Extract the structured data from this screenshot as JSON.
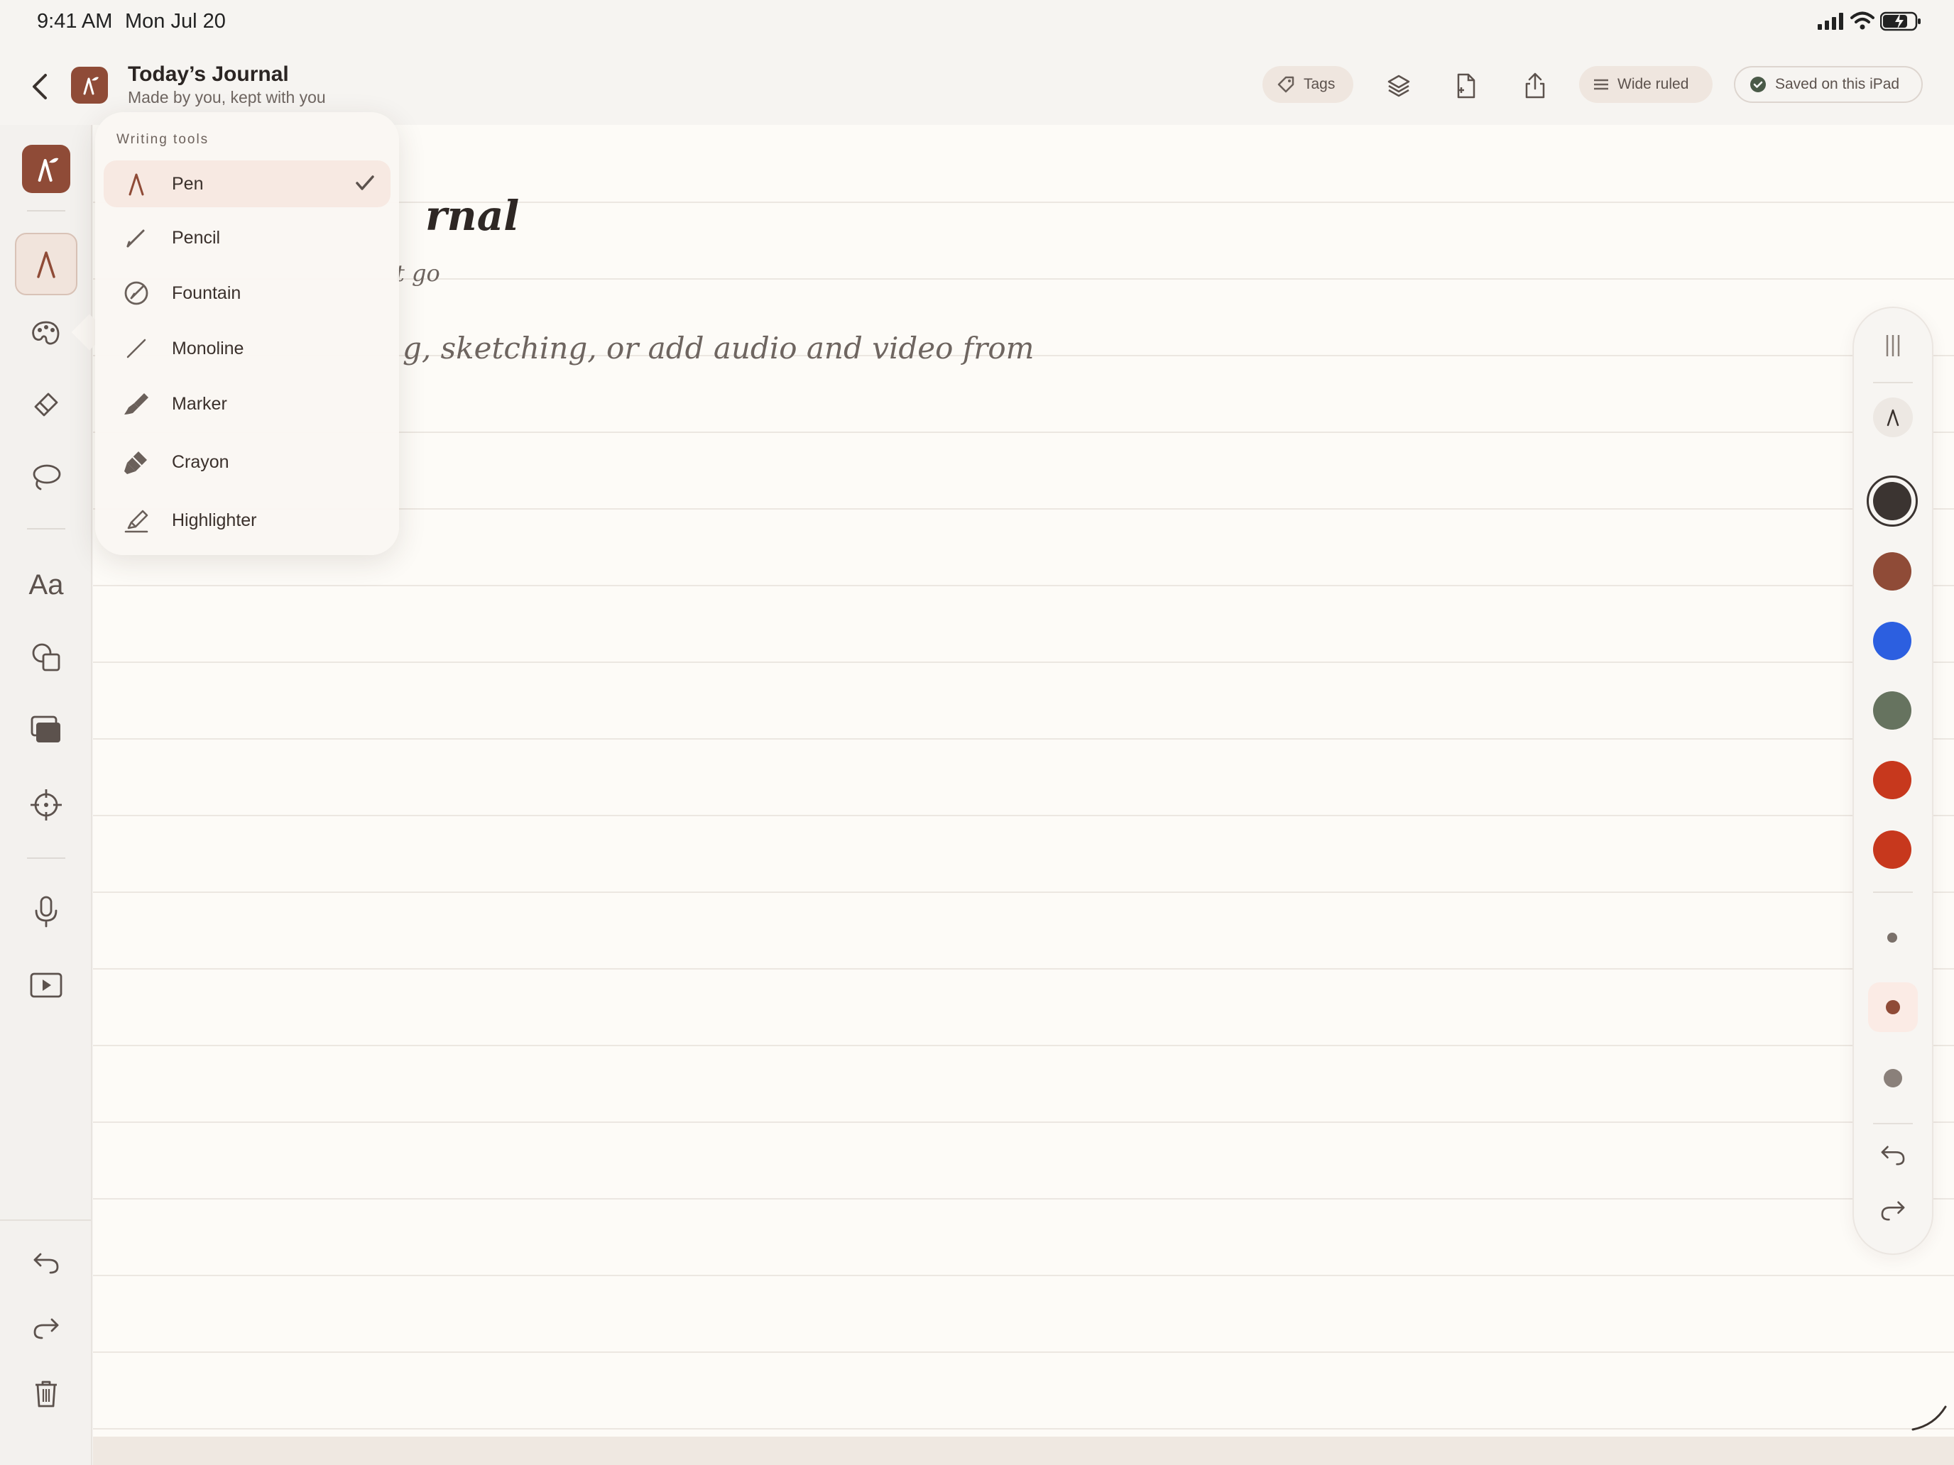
{
  "status": {
    "time": "9:41 AM",
    "date": "Mon Jul 20"
  },
  "header": {
    "title": "Today’s Journal",
    "subtitle": "Made by you, kept with you",
    "tags_label": "Tags",
    "ruling_label": "Wide ruled",
    "saved_label": "Saved on this iPad"
  },
  "page": {
    "title_partial": "rnal",
    "subtitle_partial": "t go",
    "body_partial": "g, sketching, or add audio and video from"
  },
  "writing_tools": {
    "title": "Writing tools",
    "selected": "Pen",
    "items": [
      {
        "label": "Pen",
        "icon": "pen-icon"
      },
      {
        "label": "Pencil",
        "icon": "pencil-icon"
      },
      {
        "label": "Fountain",
        "icon": "fountain-pen-icon"
      },
      {
        "label": "Monoline",
        "icon": "monoline-icon"
      },
      {
        "label": "Marker",
        "icon": "marker-icon"
      },
      {
        "label": "Crayon",
        "icon": "crayon-icon"
      },
      {
        "label": "Highlighter",
        "icon": "highlighter-icon"
      }
    ]
  },
  "left_rail": {
    "tools": [
      "app-logo-icon",
      "pen-tool-icon",
      "palette-icon",
      "eraser-icon",
      "lasso-icon",
      "text-icon",
      "shapes-icon",
      "stickers-icon",
      "target-icon",
      "microphone-icon",
      "video-icon"
    ],
    "text_tool_label": "Aa",
    "bottom": [
      "undo-icon",
      "redo-icon",
      "trash-icon"
    ]
  },
  "palette": {
    "selected_color": "#3b3431",
    "colors": [
      "#3b3431",
      "#8f4b37",
      "#2c5fe0",
      "#66735f",
      "#c7381d",
      "#c7381d"
    ],
    "selected_size": "medium",
    "sizes": [
      "small",
      "medium",
      "large"
    ]
  }
}
